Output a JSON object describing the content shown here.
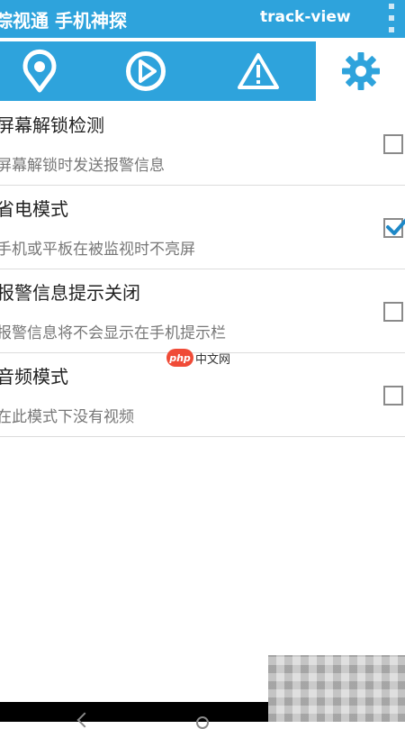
{
  "app_bar": {
    "title": "踪视通 手机神探",
    "subtitle": "track-view",
    "overflow_icon": "overflow-menu-icon"
  },
  "tabs": [
    {
      "icon": "location-pin-icon",
      "selected": false
    },
    {
      "icon": "play-icon",
      "selected": false
    },
    {
      "icon": "warning-icon",
      "selected": false
    },
    {
      "icon": "gear-icon",
      "selected": true
    }
  ],
  "settings": [
    {
      "title": "屏幕解锁检测",
      "summary": "屏幕解锁时发送报警信息",
      "checked": false
    },
    {
      "title": "省电模式",
      "summary": "手机或平板在被监视时不亮屏",
      "checked": true
    },
    {
      "title": "报警信息提示关闭",
      "summary": "报警信息将不会显示在手机提示栏",
      "checked": false
    },
    {
      "title": "音频模式",
      "summary": "在此模式下没有视频",
      "checked": false
    }
  ],
  "watermark": {
    "badge": "php",
    "text": "中文网"
  },
  "colors": {
    "accent": "#2ea3dc",
    "check": "#1e88c7",
    "background": "#ffffff",
    "divider": "#dcdcdc"
  }
}
